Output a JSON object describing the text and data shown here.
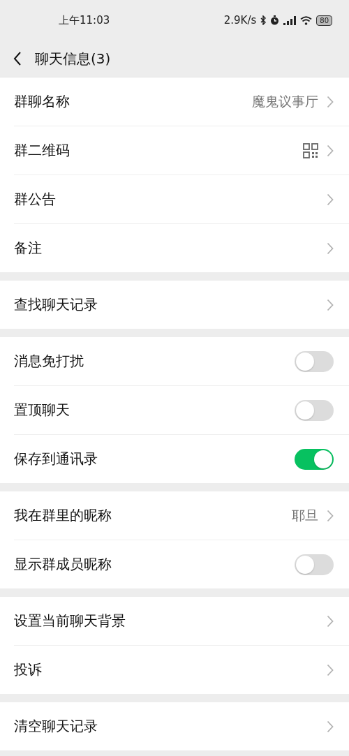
{
  "status_bar": {
    "time": "上午11:03",
    "net_speed": "2.9K/s",
    "battery": "80"
  },
  "nav": {
    "title": "聊天信息(3)"
  },
  "sections": [
    {
      "rows": [
        {
          "label": "群聊名称",
          "kind": "link",
          "value": "魔鬼议事厅"
        },
        {
          "label": "群二维码",
          "kind": "qr"
        },
        {
          "label": "群公告",
          "kind": "link"
        },
        {
          "label": "备注",
          "kind": "link"
        }
      ]
    },
    {
      "rows": [
        {
          "label": "查找聊天记录",
          "kind": "link"
        }
      ]
    },
    {
      "rows": [
        {
          "label": "消息免打扰",
          "kind": "toggle",
          "on": false
        },
        {
          "label": "置顶聊天",
          "kind": "toggle",
          "on": false
        },
        {
          "label": "保存到通讯录",
          "kind": "toggle",
          "on": true
        }
      ]
    },
    {
      "rows": [
        {
          "label": "我在群里的昵称",
          "kind": "link",
          "value": "耶旦"
        },
        {
          "label": "显示群成员昵称",
          "kind": "toggle",
          "on": false
        }
      ]
    },
    {
      "rows": [
        {
          "label": "设置当前聊天背景",
          "kind": "link"
        },
        {
          "label": "投诉",
          "kind": "link"
        }
      ]
    },
    {
      "rows": [
        {
          "label": "清空聊天记录",
          "kind": "link"
        }
      ]
    }
  ]
}
